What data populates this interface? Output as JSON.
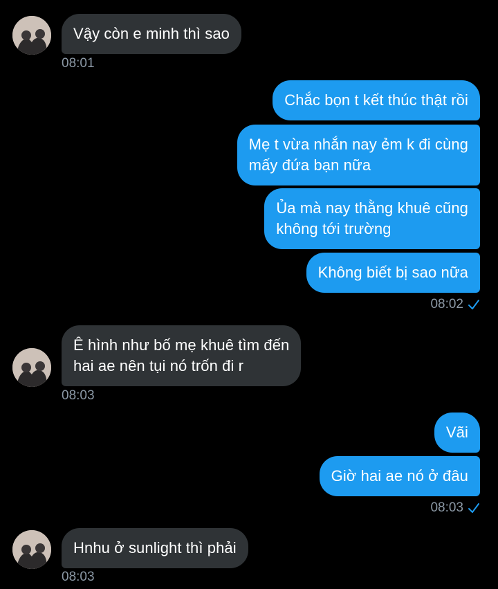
{
  "colors": {
    "background": "#000000",
    "incoming_bubble": "#2f3336",
    "outgoing_bubble": "#1d9bf0",
    "timestamp": "#8b98a5",
    "read_check": "#1d9bf0"
  },
  "messages": [
    {
      "direction": "incoming",
      "text": "Vậy còn e minh thì sao",
      "time": "08:01"
    },
    {
      "direction": "outgoing",
      "text": "Chắc bọn t kết thúc thật rồi"
    },
    {
      "direction": "outgoing",
      "text": "Mẹ t vừa nhắn nay ẻm k đi cùng\nmấy đứa bạn nữa"
    },
    {
      "direction": "outgoing",
      "text": "Ủa mà nay thằng khuê cũng\nkhông tới trường"
    },
    {
      "direction": "outgoing",
      "text": "Không biết bị sao nữa",
      "time": "08:02",
      "status_icon": "read-check-icon"
    },
    {
      "direction": "incoming",
      "text": "Ê hình như bố mẹ khuê tìm đến\nhai ae nên tụi nó trốn đi r",
      "time": "08:03"
    },
    {
      "direction": "outgoing",
      "text": "Vãi"
    },
    {
      "direction": "outgoing",
      "text": "Giờ hai ae nó ở đâu",
      "time": "08:03",
      "status_icon": "read-check-icon"
    },
    {
      "direction": "incoming",
      "text": "Hnhu ở sunlight thì phải",
      "time": "08:03"
    }
  ]
}
